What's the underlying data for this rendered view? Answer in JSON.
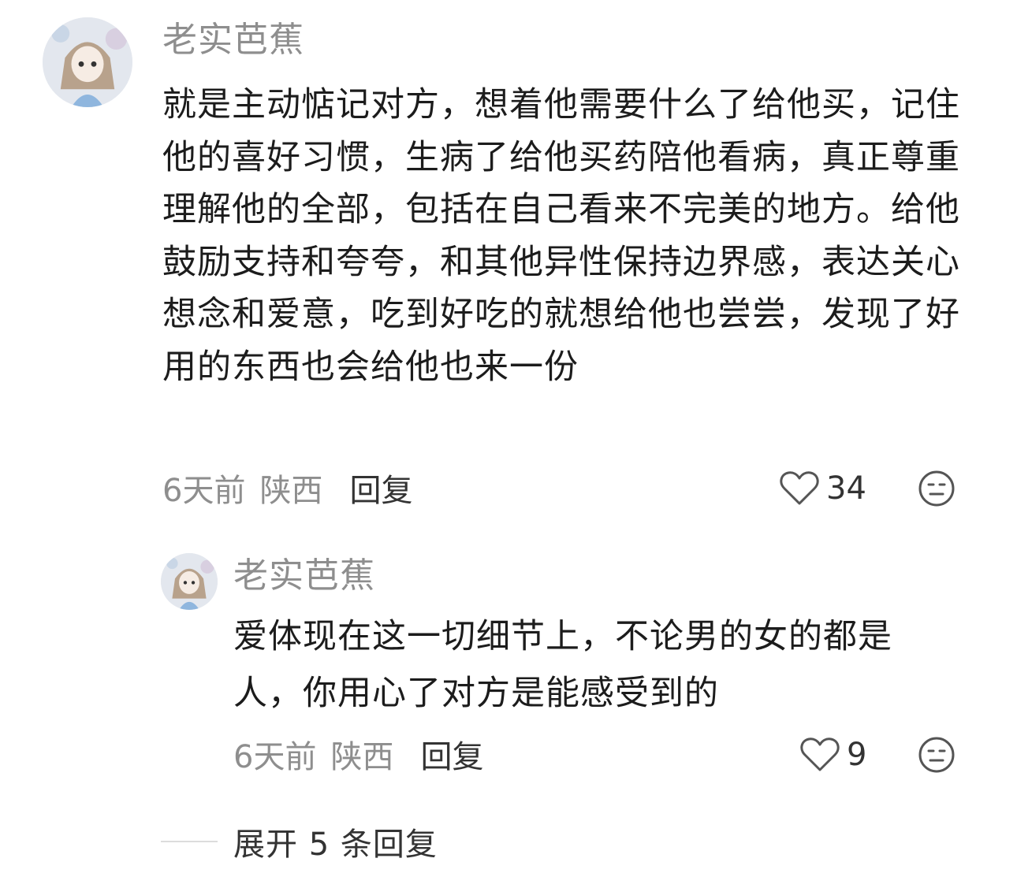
{
  "comment": {
    "username": "老实芭蕉",
    "text": "就是主动惦记对方，想着他需要什么了给他买，记住他的喜好习惯，生病了给他买药陪他看病，真正尊重理解他的全部，包括在自己看来不完美的地方。给他鼓励支持和夸夸，和其他异性保持边界感，表达关心想念和爱意，吃到好吃的就想给他也尝尝，发现了好用的东西也会给他也来一份",
    "time": "6天前",
    "location": "陕西",
    "reply_label": "回复",
    "like_count": "34",
    "like_icon": "heart-outline-icon",
    "react_icon": "emoji-face-icon"
  },
  "reply": {
    "username": "老实芭蕉",
    "text": "爱体现在这一切细节上，不论男的女的都是人，你用心了对方是能感受到的",
    "time": "6天前",
    "location": "陕西",
    "reply_label": "回复",
    "like_count": "9",
    "like_icon": "heart-outline-icon",
    "react_icon": "emoji-face-icon"
  },
  "expand_replies": {
    "label": "展开 5 条回复"
  },
  "colors": {
    "secondary_text": "#8e8e8e",
    "primary_text": "#1c1c1c",
    "divider": "#dcdcdc"
  }
}
